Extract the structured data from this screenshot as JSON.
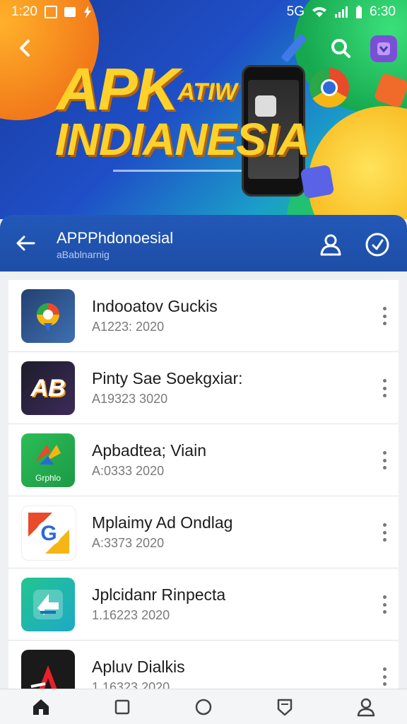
{
  "status_bar": {
    "time_left": "1:20",
    "time_right": "6:30",
    "network_label": "5G"
  },
  "hero": {
    "title_main": "APK",
    "title_small": "ATIW",
    "title_second": "INDIANESIA"
  },
  "appbar": {
    "title": "APPPhdonoesial",
    "subtitle": "aBablnarnig"
  },
  "apps": [
    {
      "name": "Indooatov Guckis",
      "meta": "A1223: 2020",
      "icon": "map-pin-icon",
      "icon_text": ""
    },
    {
      "name": "Pinty Sae Soekgxiar:",
      "meta": "A19323 3020",
      "icon": "ab-logo-icon",
      "icon_text": "AB"
    },
    {
      "name": "Apbadtea; Viain",
      "meta": "A:0333 2020",
      "icon": "graphics-icon",
      "icon_text": "Grphlo"
    },
    {
      "name": "Mplaimy Ad Ondlag",
      "meta": "A:3373 2020",
      "icon": "g-logo-icon",
      "icon_text": "G"
    },
    {
      "name": "Jplcidanr Rinpecta",
      "meta": "1.16223 2020",
      "icon": "arrow-logo-icon",
      "icon_text": ""
    },
    {
      "name": "Apluv Dialkis",
      "meta": "1.16323 2020",
      "icon": "a-logo-icon",
      "icon_text": ""
    }
  ],
  "colors": {
    "appbar": "#1e4ea6",
    "hero_title": "#ffd12b"
  }
}
